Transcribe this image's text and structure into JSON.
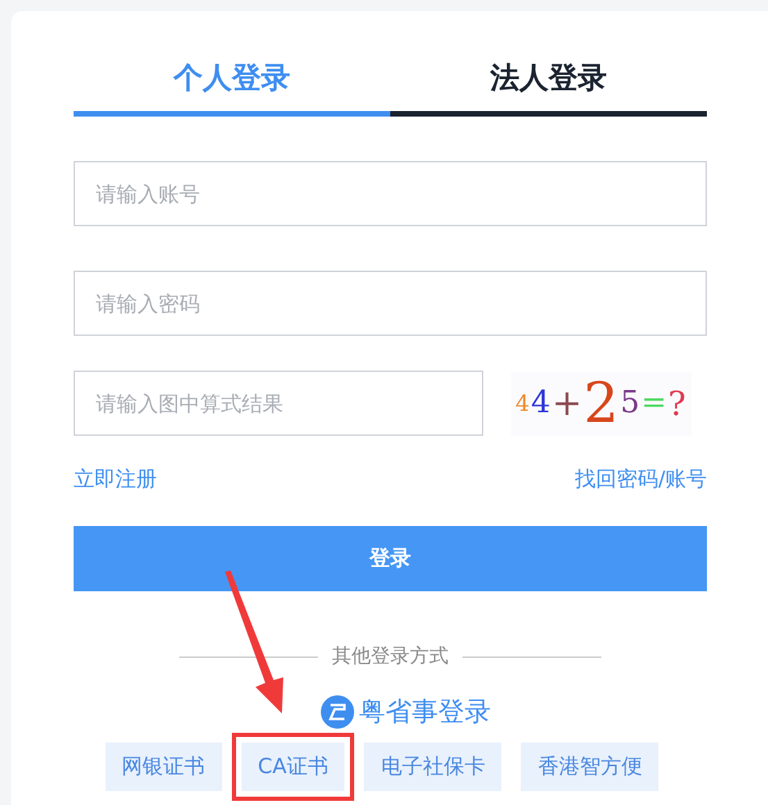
{
  "tabs": [
    {
      "label": "个人登录",
      "selected": true
    },
    {
      "label": "法人登录",
      "selected": false
    }
  ],
  "fields": [
    {
      "placeholder": "请输入账号"
    },
    {
      "placeholder": "请输入密码"
    }
  ],
  "captcha": {
    "placeholder": "请输入图中算式结果",
    "image_text": "44+25=?"
  },
  "links": [
    "立即注册",
    "找回密码/账号"
  ],
  "login_button": "登录",
  "other_title": "其他登录方式",
  "app_login": "粤省事登录",
  "methods": [
    {
      "label": "网银证书",
      "highlighted": false
    },
    {
      "label": "CA证书",
      "highlighted": true
    },
    {
      "label": "电子社保卡",
      "highlighted": false
    },
    {
      "label": "香港智方便",
      "highlighted": false
    }
  ]
}
